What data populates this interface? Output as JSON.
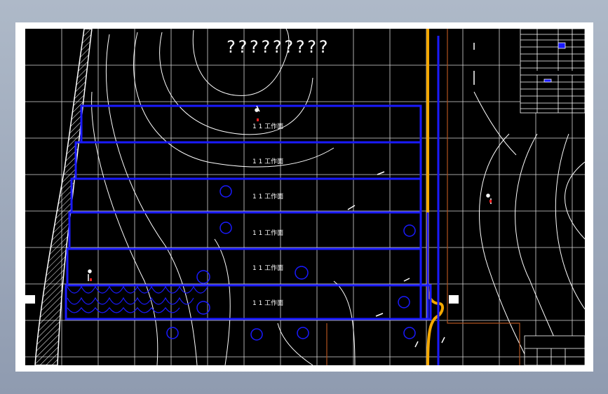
{
  "drawing": {
    "title": "?????????",
    "field_labels": [
      "1 1 工作面",
      "1 1 工作面",
      "1 1 工作面",
      "1 1 工作面",
      "1 1 工作面",
      "1 1 工作面"
    ],
    "colors": {
      "sheet": "#ffffff",
      "background": "#000000",
      "grid": "#ffffff",
      "contour": "#ffffff",
      "workface": "#1a1aff",
      "main_roadway": "#f5a800",
      "boundary": "#b0521f"
    }
  }
}
